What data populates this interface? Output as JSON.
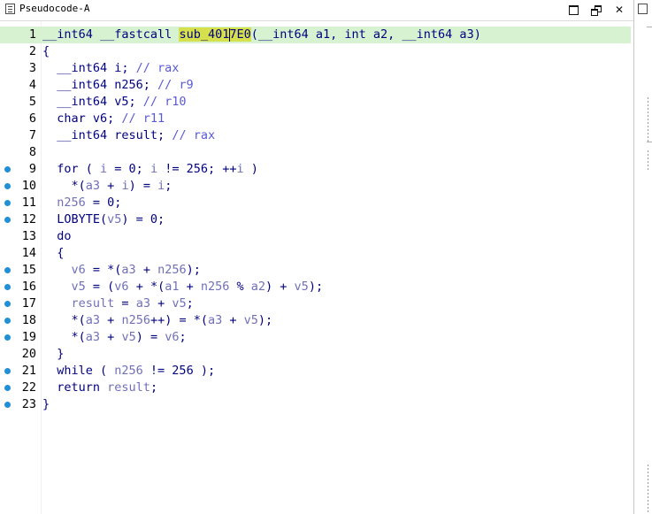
{
  "window": {
    "title": "Pseudocode-A"
  },
  "controls": {
    "maximize": "maximize",
    "restore": "restore",
    "close": "close"
  },
  "editor": {
    "current_line": 1,
    "lines": [
      {
        "n": "1",
        "dot": false
      },
      {
        "n": "2",
        "dot": false
      },
      {
        "n": "3",
        "dot": false
      },
      {
        "n": "4",
        "dot": false
      },
      {
        "n": "5",
        "dot": false
      },
      {
        "n": "6",
        "dot": false
      },
      {
        "n": "7",
        "dot": false
      },
      {
        "n": "8",
        "dot": false
      },
      {
        "n": "9",
        "dot": true
      },
      {
        "n": "10",
        "dot": true
      },
      {
        "n": "11",
        "dot": true
      },
      {
        "n": "12",
        "dot": true
      },
      {
        "n": "13",
        "dot": false
      },
      {
        "n": "14",
        "dot": false
      },
      {
        "n": "15",
        "dot": true
      },
      {
        "n": "16",
        "dot": true
      },
      {
        "n": "17",
        "dot": true
      },
      {
        "n": "18",
        "dot": true
      },
      {
        "n": "19",
        "dot": true
      },
      {
        "n": "20",
        "dot": false
      },
      {
        "n": "21",
        "dot": true
      },
      {
        "n": "22",
        "dot": true
      },
      {
        "n": "23",
        "dot": true
      }
    ],
    "code": {
      "l1_a": "__int64 __fastcall ",
      "l1_fn_a": "sub_401",
      "l1_fn_b": "7E0",
      "l1_b": "(__int64 a1, int a2, __int64 a3)",
      "l2": "{",
      "l3_a": "  __int64 i; ",
      "l3_c": "// rax",
      "l4_a": "  __int64 n256; ",
      "l4_c": "// r9",
      "l5_a": "  __int64 v5; ",
      "l5_c": "// r10",
      "l6_a": "  char v6; ",
      "l6_c": "// r11",
      "l7_a": "  __int64 result; ",
      "l7_c": "// rax",
      "l8": "",
      "l9_a": "  for ( ",
      "l9_v": "i",
      "l9_b": " = 0; ",
      "l9_v2": "i",
      "l9_c": " != 256; ++",
      "l9_v3": "i",
      "l9_d": " )",
      "l10_a": "    *(",
      "l10_v": "a3",
      "l10_b": " + ",
      "l10_v2": "i",
      "l10_c": ") = ",
      "l10_v3": "i",
      "l10_d": ";",
      "l11_v": "  n256",
      "l11_a": " = 0;",
      "l12_a": "  LOBYTE(",
      "l12_v": "v5",
      "l12_b": ") = 0;",
      "l13": "  do",
      "l14": "  {",
      "l15_a": "    ",
      "l15_v": "v6",
      "l15_b": " = *(",
      "l15_v2": "a3",
      "l15_c": " + ",
      "l15_v3": "n256",
      "l15_d": ");",
      "l16_a": "    ",
      "l16_v": "v5",
      "l16_b": " = (",
      "l16_v2": "v6",
      "l16_c": " + *(",
      "l16_v3": "a1",
      "l16_d": " + ",
      "l16_v4": "n256",
      "l16_e": " % ",
      "l16_v5": "a2",
      "l16_f": ") + ",
      "l16_v6": "v5",
      "l16_g": ");",
      "l17_a": "    ",
      "l17_v": "result",
      "l17_b": " = ",
      "l17_v2": "a3",
      "l17_c": " + ",
      "l17_v3": "v5",
      "l17_d": ";",
      "l18_a": "    *(",
      "l18_v": "a3",
      "l18_b": " + ",
      "l18_v2": "n256",
      "l18_c": "++) = *(",
      "l18_v3": "a3",
      "l18_d": " + ",
      "l18_v4": "v5",
      "l18_e": ");",
      "l19_a": "    *(",
      "l19_v": "a3",
      "l19_b": " + ",
      "l19_v2": "v5",
      "l19_c": ") = ",
      "l19_v3": "v6",
      "l19_d": ";",
      "l20": "  }",
      "l21_a": "  while ( ",
      "l21_v": "n256",
      "l21_b": " != 256 );",
      "l22_a": "  return ",
      "l22_v": "result",
      "l22_b": ";",
      "l23": "}"
    }
  },
  "colors": {
    "current_line_bg": "#d6f2d0",
    "highlight_bg": "#d6e04c",
    "breakpoint_dot": "#1f8fd6",
    "code_text": "#000080",
    "comment_text": "#5a5ad6"
  }
}
